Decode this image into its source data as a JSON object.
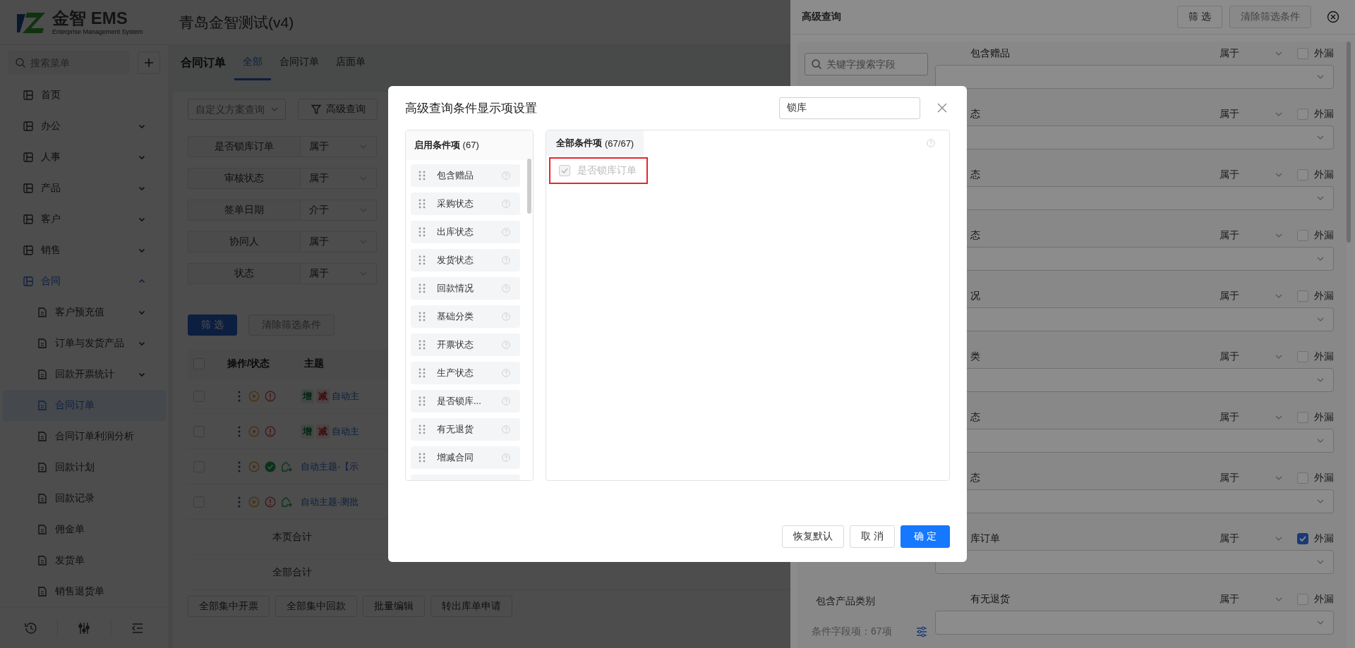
{
  "header": {
    "brand": "金智 EMS",
    "tagline": "Enterprise Management System",
    "app_title": "青岛金智测试(v4)"
  },
  "sidebar": {
    "search": {
      "placeholder": "搜索菜单"
    },
    "items": [
      {
        "label": "首页",
        "selected": false
      },
      {
        "label": "办公",
        "selected": false,
        "expanded": false
      },
      {
        "label": "人事",
        "selected": false,
        "expanded": false
      },
      {
        "label": "产品",
        "selected": false,
        "expanded": false
      },
      {
        "label": "客户",
        "selected": false,
        "expanded": false
      },
      {
        "label": "销售",
        "selected": false,
        "expanded": false
      },
      {
        "label": "合同",
        "selected": true,
        "expanded": true,
        "children": [
          {
            "label": "客户预充值",
            "selected": false,
            "expanded": false
          },
          {
            "label": "订单与发货产品",
            "selected": false,
            "expanded": false
          },
          {
            "label": "回款开票统计",
            "selected": false,
            "expanded": false
          },
          {
            "label": "合同订单",
            "selected": true
          },
          {
            "label": "合同订单利润分析",
            "selected": false
          },
          {
            "label": "回款计划",
            "selected": false
          },
          {
            "label": "回款记录",
            "selected": false
          },
          {
            "label": "佣金单",
            "selected": false
          },
          {
            "label": "发货单",
            "selected": false
          },
          {
            "label": "销售退货单",
            "selected": false
          }
        ]
      }
    ]
  },
  "page": {
    "title": "合同订单",
    "tabs": [
      {
        "label": "全部",
        "selected": true
      },
      {
        "label": "合同订单",
        "selected": false
      },
      {
        "label": "店面单",
        "selected": false
      }
    ],
    "scheme_select": {
      "placeholder": "自定义方案查询"
    },
    "advanced_button": "高级查询",
    "conditions": [
      {
        "label": "是否锁库订单",
        "operator": "属于"
      },
      {
        "label": "审核状态",
        "operator": "属于"
      },
      {
        "label": "签单日期",
        "operator": "介于"
      },
      {
        "label": "协同人",
        "operator": "属于"
      },
      {
        "label": "状态",
        "operator": "属于"
      }
    ],
    "buttons": [
      {
        "label": "筛 选",
        "kind": "primary",
        "disabled": false
      },
      {
        "label": "清除筛选条件",
        "kind": "default",
        "disabled": true
      }
    ],
    "table": {
      "checked": false,
      "columns": [
        "操作/状态",
        "主题"
      ],
      "rows": [
        {
          "checked": false,
          "approved": false,
          "shared": false,
          "tags": [
            {
              "label": "增",
              "kind": "increase"
            },
            {
              "label": "减",
              "kind": "decrease"
            }
          ],
          "subject": "自动主"
        },
        {
          "checked": false,
          "approved": false,
          "shared": false,
          "tags": [
            {
              "label": "增",
              "kind": "increase"
            },
            {
              "label": "减",
              "kind": "decrease"
            }
          ],
          "subject": "自动主"
        },
        {
          "checked": false,
          "approved": true,
          "shared": true,
          "tags": [],
          "subject": "自动主题-【示"
        },
        {
          "checked": false,
          "approved": false,
          "shared": true,
          "tags": [],
          "subject": "自动主题-测批"
        }
      ]
    },
    "summary": [
      "本页合计",
      "全部合计"
    ],
    "actions": [
      "全部集中开票",
      "全部集中回款",
      "批量编辑",
      "转出库单申请"
    ]
  },
  "drawer": {
    "title": "高级查询",
    "buttons": [
      {
        "label": "筛 选",
        "disabled": false
      },
      {
        "label": "清除筛选条件",
        "disabled": true
      }
    ],
    "search": {
      "placeholder": "关键字搜索字段"
    },
    "fields": [
      "包含产品类别"
    ],
    "field_count": "条件字段项：67项",
    "conditions": [
      {
        "label": "包含赠品",
        "operator": "属于",
        "leak_label": "外漏",
        "leak_checked": false
      },
      {
        "label": "态",
        "operator": "属于",
        "leak_label": "外漏",
        "leak_checked": false
      },
      {
        "label": "态",
        "operator": "属于",
        "leak_label": "外漏",
        "leak_checked": false
      },
      {
        "label": "态",
        "operator": "属于",
        "leak_label": "外漏",
        "leak_checked": false
      },
      {
        "label": "况",
        "operator": "属于",
        "leak_label": "外漏",
        "leak_checked": false
      },
      {
        "label": "类",
        "operator": "属于",
        "leak_label": "外漏",
        "leak_checked": false
      },
      {
        "label": "态",
        "operator": "属于",
        "leak_label": "外漏",
        "leak_checked": false
      },
      {
        "label": "态",
        "operator": "属于",
        "leak_label": "外漏",
        "leak_checked": false
      },
      {
        "label": "库订单",
        "operator": "属于",
        "leak_label": "外漏",
        "leak_checked": true
      },
      {
        "label": "有无退货",
        "operator": "属于",
        "leak_label": "外漏",
        "leak_checked": false
      }
    ]
  },
  "modal": {
    "title": "高级查询条件显示项设置",
    "search": {
      "value": "锁库"
    },
    "enabled": {
      "title": "启用条件项",
      "count": "(67)",
      "items": [
        "包含赠品",
        "采购状态",
        "出库状态",
        "发货状态",
        "回款情况",
        "基础分类",
        "开票状态",
        "生产状态",
        "是否锁库...",
        "有无退货",
        "增减合同"
      ]
    },
    "all": {
      "title": "全部条件项",
      "count": "(67/67)",
      "items": [
        {
          "label": "是否锁库订单",
          "checked": true,
          "disabled": true,
          "highlighted": true
        }
      ]
    },
    "buttons": [
      {
        "label": "恢复默认",
        "kind": "default"
      },
      {
        "label": "取 消",
        "kind": "default"
      },
      {
        "label": "确 定",
        "kind": "primary"
      }
    ]
  }
}
